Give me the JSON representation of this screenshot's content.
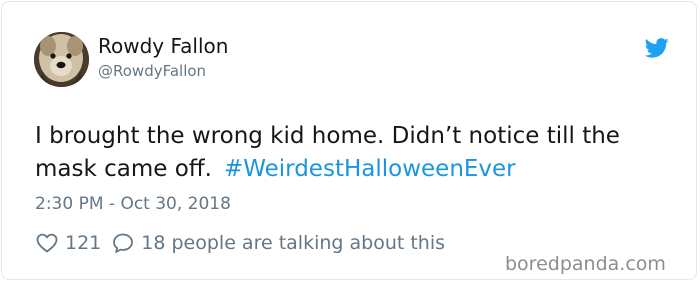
{
  "author": {
    "display_name": "Rowdy Fallon",
    "handle": "@RowdyFallon"
  },
  "icons": {
    "brand": "twitter-bird-icon",
    "like": "heart-outline-icon",
    "reply": "speech-bubble-icon",
    "brand_color": "#1da1f2"
  },
  "tweet": {
    "text": "I brought the wrong kid home. Didn’t notice till the mask came off.",
    "hashtag": "#WeirdestHalloweenEver",
    "hashtag_color": "#1b95e0",
    "timestamp": "2:30 PM - Oct 30, 2018"
  },
  "engagement": {
    "likes": "121",
    "talking": "18 people are talking about this"
  },
  "watermark": "boredpanda.com"
}
